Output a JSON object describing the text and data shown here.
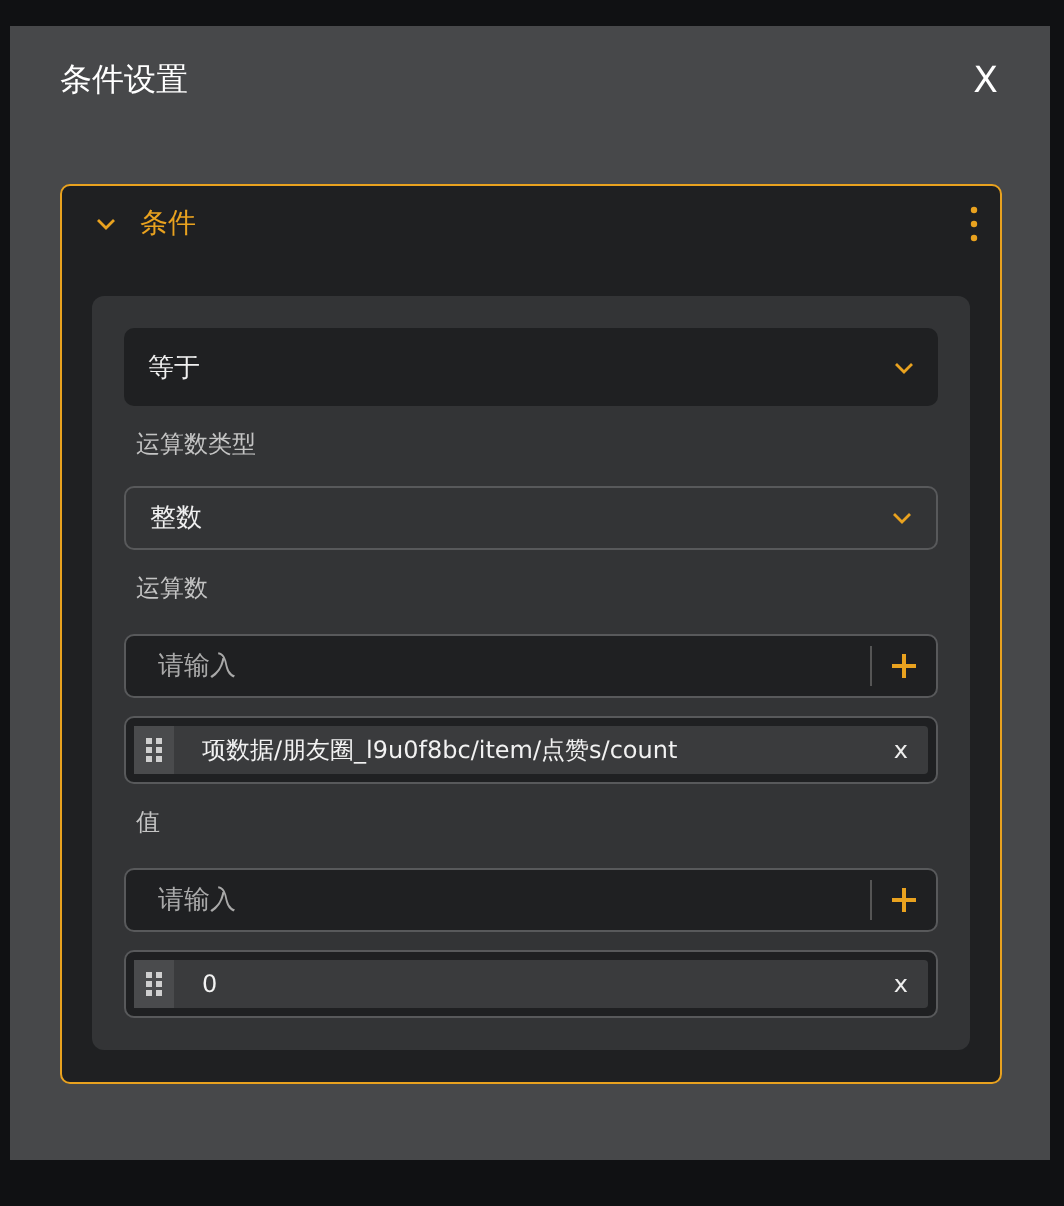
{
  "dialog": {
    "title": "条件设置",
    "close": "X"
  },
  "condition_panel": {
    "title": "条件",
    "expanded": true,
    "operator": {
      "value": "等于"
    },
    "fields": [
      {
        "kind": "select",
        "label": "运算数类型",
        "value": "整数"
      },
      {
        "kind": "list",
        "label": "运算数",
        "input": {
          "placeholder": "请输入"
        },
        "items": [
          {
            "text": "项数据/朋友圈_l9u0f8bc/item/点赞s/count",
            "remove": "x"
          }
        ]
      },
      {
        "kind": "list",
        "label": "值",
        "input": {
          "placeholder": "请输入"
        },
        "items": [
          {
            "text": "0",
            "remove": "x"
          }
        ]
      }
    ]
  }
}
